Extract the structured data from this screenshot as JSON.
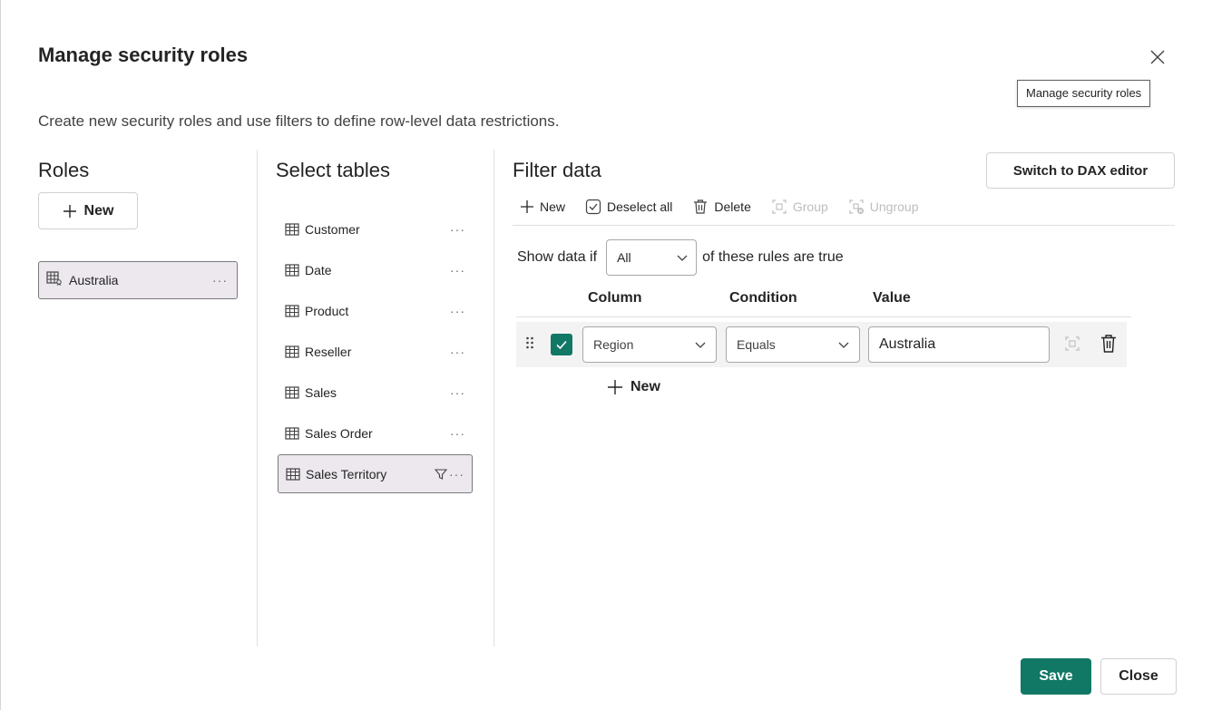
{
  "dialog": {
    "title": "Manage security roles",
    "tooltip": "Manage security roles",
    "subtitle": "Create new security roles and use filters to define row-level data restrictions."
  },
  "roles": {
    "heading": "Roles",
    "new_label": "New",
    "items": [
      {
        "label": "Australia",
        "selected": true
      }
    ]
  },
  "tables": {
    "heading": "Select tables",
    "items": [
      {
        "label": "Customer"
      },
      {
        "label": "Date"
      },
      {
        "label": "Product"
      },
      {
        "label": "Reseller"
      },
      {
        "label": "Sales"
      },
      {
        "label": "Sales Order"
      },
      {
        "label": "Sales Territory",
        "selected": true,
        "filtered": true
      }
    ]
  },
  "filter": {
    "heading": "Filter data",
    "dax_button": "Switch to DAX editor",
    "toolbar": {
      "new": "New",
      "deselect_all": "Deselect all",
      "delete": "Delete",
      "group": "Group",
      "ungroup": "Ungroup"
    },
    "show_prefix": "Show data if",
    "show_selected": "All",
    "show_suffix": "of these rules are true",
    "columns": {
      "column": "Column",
      "condition": "Condition",
      "value": "Value"
    },
    "rule": {
      "checked": true,
      "column": "Region",
      "condition": "Equals",
      "value": "Australia"
    },
    "new_rule_label": "New"
  },
  "footer": {
    "save": "Save",
    "close": "Close"
  },
  "colors": {
    "accent": "#117865",
    "selected_bg": "#ece8ee"
  }
}
